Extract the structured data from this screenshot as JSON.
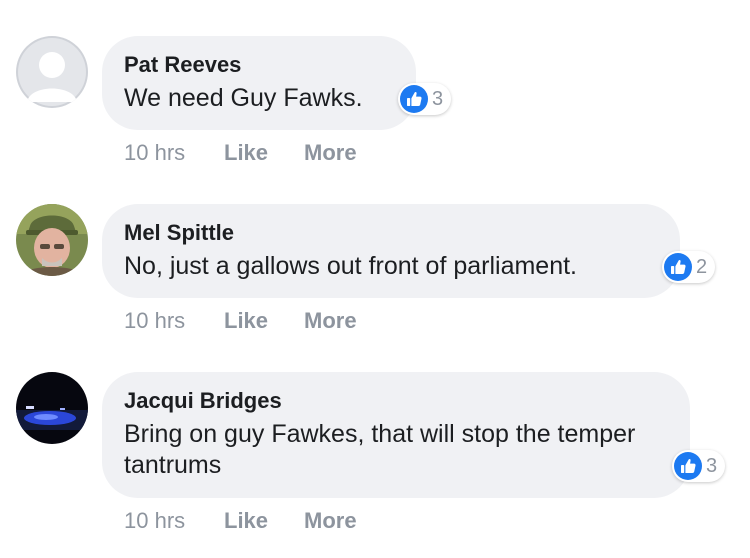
{
  "comments": [
    {
      "author": "Pat Reeves",
      "text": "We need Guy Fawks.",
      "reactions": "3",
      "time": "10 hrs",
      "like_label": "Like",
      "more_label": "More",
      "avatar": "default-avatar-icon"
    },
    {
      "author": "Mel Spittle",
      "text": "No, just a gallows out front of parliament.",
      "reactions": "2",
      "time": "10 hrs",
      "like_label": "Like",
      "more_label": "More",
      "avatar": "profile-photo"
    },
    {
      "author": "Jacqui Bridges",
      "text": "Bring on guy Fawkes, that will stop the temper tantrums",
      "reactions": "3",
      "time": "10 hrs",
      "like_label": "Like",
      "more_label": "More",
      "avatar": "profile-photo"
    }
  ],
  "colors": {
    "bubble": "#f0f1f4",
    "like_blue": "#1d7af1",
    "meta_gray": "#8d949e",
    "text": "#1c1e21"
  }
}
